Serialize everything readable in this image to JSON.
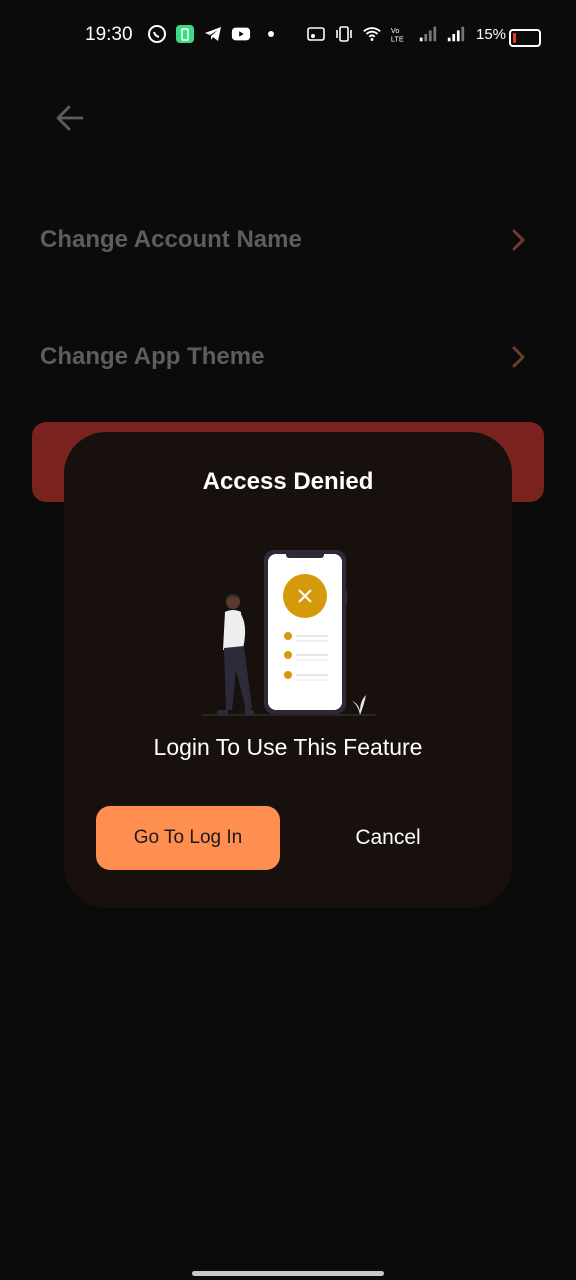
{
  "status_bar": {
    "time": "19:30",
    "battery_percent": "15%",
    "battery_level": 0.15,
    "icons_left": [
      "whatsapp-icon",
      "battery-saver-icon",
      "telegram-icon",
      "youtube-icon",
      "dot-icon"
    ],
    "icons_right": [
      "cast-icon",
      "vibrate-icon",
      "wifi-icon",
      "volte-icon",
      "signal-icon",
      "signal-icon"
    ]
  },
  "header": {
    "back_icon": "arrow-left-icon"
  },
  "settings": {
    "items": [
      {
        "label": "Change Account Name",
        "icon": "chevron-right-icon"
      },
      {
        "label": "Change App Theme",
        "icon": "chevron-right-icon"
      }
    ]
  },
  "dialog": {
    "title": "Access Denied",
    "message": "Login To Use This Feature",
    "primary_button": "Go To Log In",
    "cancel_button": "Cancel",
    "illustration": "person-with-phone-denied-illustration"
  },
  "colors": {
    "background": "#0b0b0b",
    "dialog": "#17100d",
    "accent_orange": "#ff8f51",
    "card_red": "#7a221f",
    "deny_badge": "#d49a0c",
    "chevron": "#6b3d2e"
  }
}
